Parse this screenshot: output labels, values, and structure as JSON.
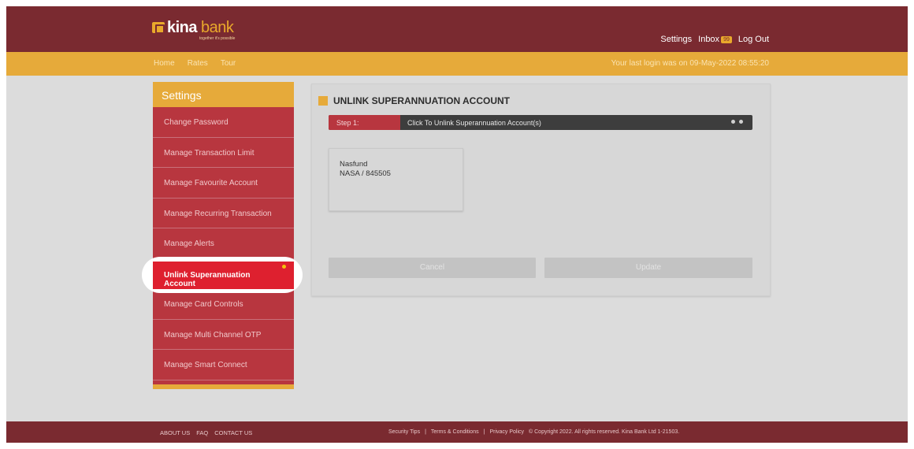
{
  "header": {
    "logo_brand_first": "kina",
    "logo_brand_second": "bank",
    "logo_tagline": "together it's possible",
    "links": {
      "settings": "Settings",
      "inbox": "Inbox",
      "inbox_badge": "99",
      "logout": "Log Out"
    }
  },
  "nav": {
    "items": [
      "Home",
      "Rates",
      "Tour"
    ],
    "last_login": "Your last login was on 09-May-2022 08:55:20"
  },
  "sidebar": {
    "title": "Settings",
    "items": [
      "Change Password",
      "Manage Transaction Limit",
      "Manage Favourite Account",
      "Manage Recurring Transaction",
      "Manage Alerts",
      "Unlink Superannuation Account",
      "Manage Card Controls",
      "Manage Multi Channel OTP",
      "Manage Smart Connect"
    ],
    "active_index": 5
  },
  "main": {
    "title": "UNLINK SUPERANNUATION ACCOUNT",
    "step_label": "Step 1:",
    "step_text": "Click To Unlink Superannuation Account(s)",
    "account": {
      "name": "Nasfund",
      "number": "NASA / 845505"
    },
    "buttons": {
      "cancel": "Cancel",
      "update": "Update"
    }
  },
  "footer": {
    "left": [
      "ABOUT US",
      "FAQ",
      "CONTACT US"
    ],
    "right": [
      "Security Tips",
      "|",
      "Terms & Conditions",
      "|",
      "Privacy Policy",
      "© Copyright 2022. All rights reserved. Kina Bank Ltd 1-21503."
    ]
  },
  "colors": {
    "header_maroon": "#7a2a30",
    "nav_gold": "#e6aa3a",
    "sidebar_red": "#b8363f",
    "active_red": "#de202f"
  }
}
